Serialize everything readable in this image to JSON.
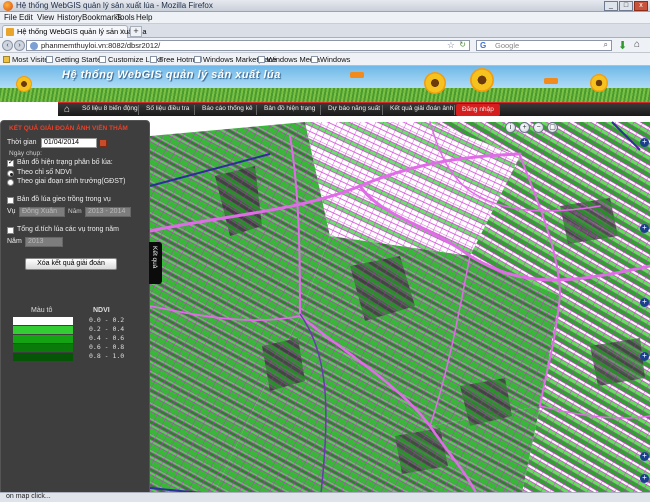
{
  "window": {
    "title": "Hệ thống WebGIS quản lý sản xuất lúa - Mozilla Firefox",
    "buttons": [
      "_",
      "□",
      "x"
    ]
  },
  "menu": [
    "File",
    "Edit",
    "View",
    "History",
    "Bookmarks",
    "Tools",
    "Help"
  ],
  "tab": {
    "label": "Hệ thống WebGIS quản lý sản xuất lúa",
    "close": "x",
    "new": "+"
  },
  "nav": {
    "back": "‹",
    "forward": "›",
    "url": "phanmemthuyloi.vn:8082/dbsr2012/",
    "search_engine": "G",
    "search_placeholder": "Google"
  },
  "bookmarks": [
    "Most Visited",
    "Getting Started",
    "Customize Links",
    "Free Hotmail",
    "Windows Marketplace",
    "Windows Media",
    "Windows"
  ],
  "banner": {
    "title": "Hệ thống WebGIS quản lý sản xuất lúa"
  },
  "site_nav": {
    "items": [
      "Số liệu 8 biến động",
      "Số liệu điều tra",
      "Báo cáo thống kê",
      "Bản đồ hiện trạng",
      "Dự báo năng suất",
      "Kết quả giải đoán ảnh",
      "Đăng nhập"
    ]
  },
  "panel": {
    "header": "KẾT QUẢ GIẢI ĐOÁN ẢNH VIỄN THÁM",
    "time_label": "Thời gian",
    "time_value": "01/04/2014",
    "capture_label": "Ngày chụp:",
    "section1": "Bản đồ hiện trạng phân bố lúa:",
    "radio1": "Theo chỉ số NDVI",
    "radio2": "Theo giai đoạn sinh trưởng(GĐST)",
    "section2": "Bản đồ lúa gieo trồng trong vụ",
    "season_label": "Vụ",
    "season_value": "Đông Xuân",
    "season_year": "2013 - 2014",
    "section3": "Tổng d.tích lúa các vụ trong năm",
    "year_label": "Năm",
    "year_value": "2013",
    "clear_button": "Xóa kết quả giải đoán",
    "tab_side": "Kết quả"
  },
  "legend": {
    "color_title": "Màu tô",
    "value_title": "NDVI",
    "entries": [
      {
        "label": "0.0 - 0.2",
        "color": "#ffffff"
      },
      {
        "label": "0.2 - 0.4",
        "color": "#33cc33"
      },
      {
        "label": "0.4 - 0.6",
        "color": "#13a313"
      },
      {
        "label": "0.6 - 0.8",
        "color": "#0a7a0a"
      },
      {
        "label": "0.8 - 1.0",
        "color": "#065406"
      }
    ]
  },
  "status": {
    "text": "on map click..."
  },
  "colors": {
    "parcel_border": "#d02ad6",
    "road": "#e06ce8",
    "admin_line": "#2a2f9a",
    "active_nav": "#d51f1f"
  }
}
